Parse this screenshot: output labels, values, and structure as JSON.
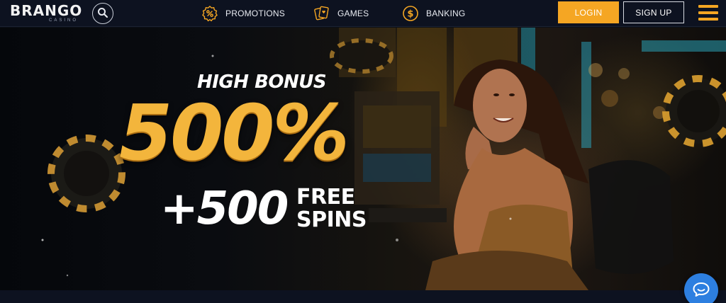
{
  "brand": {
    "name": "BRANGO",
    "tagline": "CASINO"
  },
  "nav": {
    "items": [
      {
        "label": "PROMOTIONS",
        "icon": "percent-badge-icon"
      },
      {
        "label": "GAMES",
        "icon": "playing-cards-icon"
      },
      {
        "label": "BANKING",
        "icon": "dollar-coin-icon"
      }
    ]
  },
  "auth": {
    "login_label": "LOGIN",
    "signup_label": "SIGN UP"
  },
  "hero": {
    "subtitle": "HIGH BONUS",
    "percent": "500%",
    "plus_spins": "+500",
    "spins_line1": "FREE",
    "spins_line2": "SPINS"
  },
  "colors": {
    "accent": "#f5a623",
    "header_bg": "#0d1220",
    "chat": "#2d7fe0",
    "gold_text": "#f3b53c"
  },
  "icons": {
    "search": "search-icon",
    "menu": "hamburger-menu-icon",
    "chat": "chat-bubble-icon"
  }
}
